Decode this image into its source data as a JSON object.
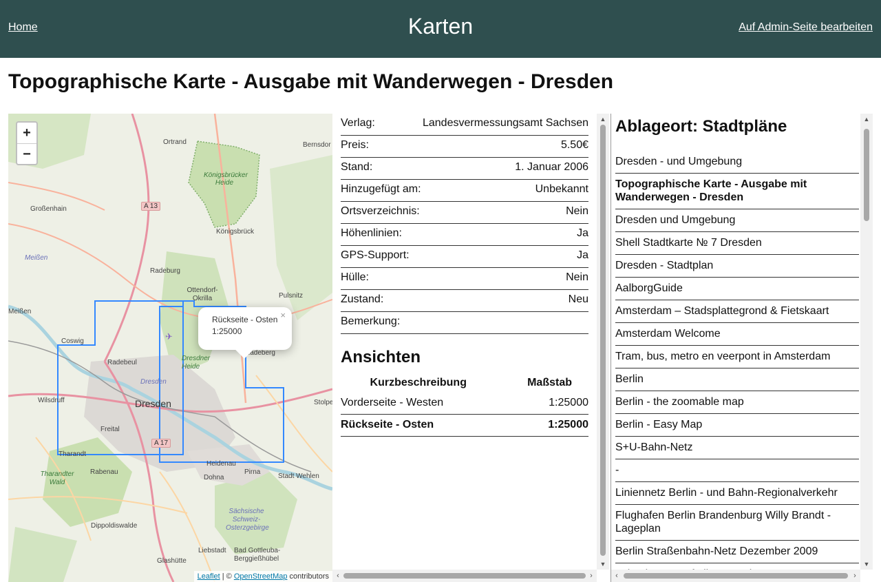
{
  "header": {
    "home_label": "Home",
    "title": "Karten",
    "admin_label": "Auf Admin-Seite bearbeiten"
  },
  "page_title": "Topographische Karte - Ausgabe mit Wanderwegen - Dresden",
  "map": {
    "zoom_in": "+",
    "zoom_out": "−",
    "popup": {
      "line1": "Rückseite - Osten",
      "line2": "1:25000",
      "close": "×"
    },
    "attribution": {
      "leaflet": "Leaflet",
      "sep": " | © ",
      "osm": "OpenStreetMap",
      "contrib": " contributors"
    },
    "labels": {
      "ottendorf_okrilla": "Ottendorf-Okrilla",
      "koenigsbrueck": "Königsbrück",
      "koenigsbruecker_heide": "Königsbrücker Heide",
      "grossenhain": "Großenhain",
      "radeburg": "Radeburg",
      "coswig": "Coswig",
      "radebeul": "Radebeul",
      "dresden": "Dresden",
      "dresdner_heide": "Dresdner Heide",
      "wilsdruff": "Wilsdruff",
      "freital": "Freital",
      "tharandt": "Tharandt",
      "tharandter_wald": "Tharandter Wald",
      "rabenau": "Rabenau",
      "heidenau": "Heidenau",
      "pirna": "Pirna",
      "dohna": "Dohna",
      "stadt_wehlen": "Stadt Wehlen",
      "dippoldiswalde": "Dippoldiswalde",
      "saechsische_schweiz": "Sächsische Schweiz-Osterzgebirge",
      "liebstadt": "Liebstadt",
      "bad_gottleuba": "Bad Gottleuba-Berggießhübel",
      "glashuette": "Glashütte",
      "meissen": "Meißen",
      "meissen_river": "Meißen",
      "pulsnitz": "Pulsnitz",
      "ortrand": "Ortrand",
      "bernsdorf": "Bernsdor",
      "radeberg": "Radeberg",
      "stolpen": "Stolpe",
      "a13": "A 13",
      "a17": "A 17"
    }
  },
  "properties": [
    {
      "label": "Verlag:",
      "value": "Landesvermessungsamt Sachsen"
    },
    {
      "label": "Preis:",
      "value": "5.50€"
    },
    {
      "label": "Stand:",
      "value": "1. Januar 2006"
    },
    {
      "label": "Hinzugefügt am:",
      "value": "Unbekannt"
    },
    {
      "label": "Ortsverzeichnis:",
      "value": "Nein"
    },
    {
      "label": "Höhenlinien:",
      "value": "Ja"
    },
    {
      "label": "GPS-Support:",
      "value": "Ja"
    },
    {
      "label": "Hülle:",
      "value": "Nein"
    },
    {
      "label": "Zustand:",
      "value": "Neu"
    },
    {
      "label": "Bemerkung:",
      "value": ""
    }
  ],
  "views": {
    "title": "Ansichten",
    "col_desc": "Kurzbeschreibung",
    "col_scale": "Maßstab",
    "rows": [
      {
        "desc": "Vorderseite - Westen",
        "scale": "1:25000"
      },
      {
        "desc": "Rückseite - Osten",
        "scale": "1:25000"
      }
    ]
  },
  "storage": {
    "title": "Ablageort: Stadtpläne",
    "items": [
      "Dresden - und Umgebung",
      "Topographische Karte - Ausgabe mit Wanderwegen - Dresden",
      "Dresden und Umgebung",
      "Shell Stadtkarte № 7 Dresden",
      "Dresden - Stadtplan",
      "AalborgGuide",
      "Amsterdam – Stadsplattegrond & Fietskaart",
      "Amsterdam Welcome",
      "Tram, bus, metro en veerpont in Amsterdam",
      "Berlin",
      "Berlin - the zoomable map",
      "Berlin - Easy Map",
      "S+U-Bahn-Netz",
      "-",
      "Liniennetz Berlin - und Bahn-Regionalverkehr",
      "Flughafen Berlin Brandenburg Willy Brandt - Lageplan",
      "Berlin Straßenbahn-Netz Dezember 2009",
      "Orientierung auf allen Strecken"
    ]
  }
}
